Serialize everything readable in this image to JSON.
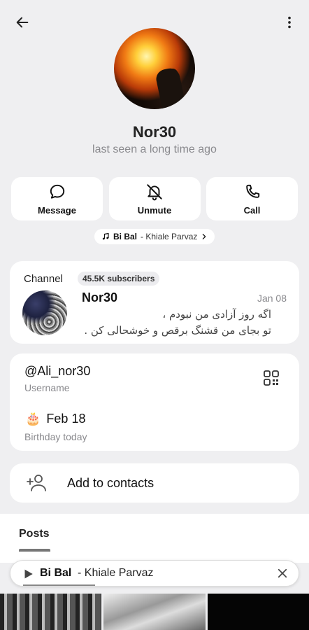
{
  "profile": {
    "name": "Nor30",
    "status": "last seen a long time ago"
  },
  "actions": [
    {
      "label": "Message",
      "icon": "chat-bubble-icon"
    },
    {
      "label": "Unmute",
      "icon": "bell-off-icon"
    },
    {
      "label": "Call",
      "icon": "phone-icon"
    }
  ],
  "music": {
    "song": "Bi Bal",
    "artist": "- Khiale Parvaz"
  },
  "channel": {
    "label": "Channel",
    "subscribers": "45.5K subscribers",
    "name": "Nor30",
    "date": "Jan 08",
    "message_line1": "اگه روز آزادی من نبودم ،",
    "message_line2": "تو بجای من قشنگ برقص و خوشحالی کن ."
  },
  "info": {
    "username": "@Ali_nor30",
    "username_caption": "Username",
    "birthday_emoji": "🎂",
    "birthday": "Feb 18",
    "birthday_caption": "Birthday today"
  },
  "contacts": {
    "label": "Add to contacts"
  },
  "tabs": {
    "posts": "Posts"
  },
  "player": {
    "song": "Bi Bal",
    "artist": "- Khiale Parvaz",
    "progress": 0.25
  },
  "colors": {
    "background": "#efeff1",
    "card": "#ffffff",
    "muted_text": "#8a8a8e"
  }
}
